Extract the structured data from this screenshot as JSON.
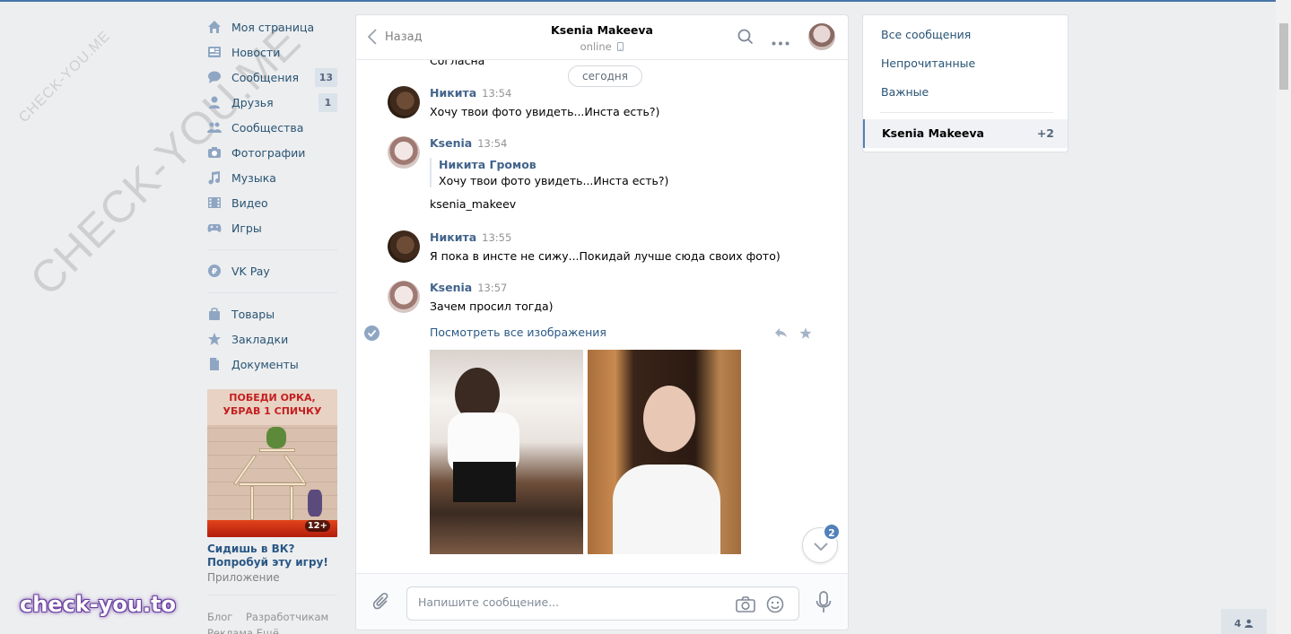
{
  "watermark": {
    "small": "CHECK-YOU.ME",
    "large": "CHECK-YOU.ME",
    "brand": "check-you.to"
  },
  "nav": {
    "items": [
      {
        "label": "Моя страница",
        "icon": "home-icon"
      },
      {
        "label": "Новости",
        "icon": "news-icon"
      },
      {
        "label": "Сообщения",
        "icon": "messages-icon",
        "count": "13"
      },
      {
        "label": "Друзья",
        "icon": "friends-icon",
        "count": "1"
      },
      {
        "label": "Сообщества",
        "icon": "groups-icon"
      },
      {
        "label": "Фотографии",
        "icon": "camera-icon"
      },
      {
        "label": "Музыка",
        "icon": "music-icon"
      },
      {
        "label": "Видео",
        "icon": "video-icon"
      },
      {
        "label": "Игры",
        "icon": "gamepad-icon"
      }
    ],
    "vkpay": {
      "label": "VK Pay",
      "icon": "vkpay-icon"
    },
    "extra": [
      {
        "label": "Товары",
        "icon": "bag-icon"
      },
      {
        "label": "Закладки",
        "icon": "star-icon"
      },
      {
        "label": "Документы",
        "icon": "document-icon"
      }
    ]
  },
  "ad": {
    "banner_line1": "ПОБЕДИ ОРКА,",
    "banner_line2": "УБРАВ 1 СПИЧКУ",
    "age": "12+",
    "title": "Сидишь в ВК? Попробуй эту игру!",
    "subtitle": "Приложение"
  },
  "footer": {
    "links": [
      "Блог",
      "Разработчикам"
    ],
    "links2": "Реклама   Ещё ..."
  },
  "chat": {
    "back_label": "Назад",
    "peer_name": "Ksenia Makeeva",
    "peer_status": "online",
    "cut_text": "Согласна",
    "date_pill": "сегодня",
    "messages": [
      {
        "author": "Никита",
        "time": "13:54",
        "text": "Хочу твои фото увидеть...Инста есть?)"
      },
      {
        "author": "Ksenia",
        "time": "13:54",
        "quote_author": "Никита Громов",
        "quote_text": "Хочу твои фото увидеть...Инста есть?)",
        "text": "ksenia_makeev"
      },
      {
        "author": "Никита",
        "time": "13:55",
        "text": "Я пока в инсте не сижу...Покидай лучше сюда своих фото)"
      },
      {
        "author": "Ksenia",
        "time": "13:57",
        "text": "Зачем просил тогда)"
      }
    ],
    "see_all": "Посмотреть все изображения",
    "unread_badge": "2",
    "input_placeholder": "Напишите сообщение..."
  },
  "right_panel": {
    "filters": [
      "Все сообщения",
      "Непрочитанные",
      "Важные"
    ],
    "selected": {
      "name": "Ksenia Makeeva",
      "count": "+2"
    }
  },
  "online_count": "4",
  "colors": {
    "accent": "#4a76a8",
    "link": "#2a5885",
    "badge": "#5181b8"
  }
}
